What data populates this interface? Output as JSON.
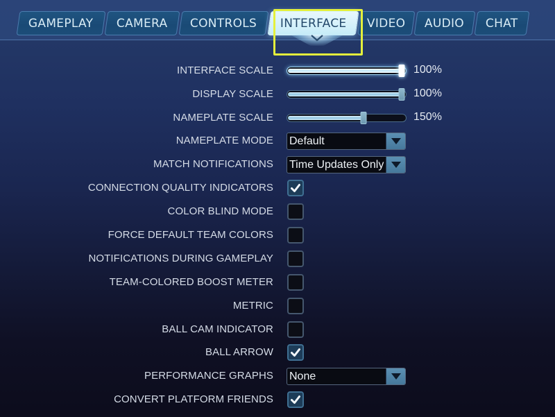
{
  "tabs": [
    {
      "label": "GAMEPLAY",
      "active": false
    },
    {
      "label": "CAMERA",
      "active": false
    },
    {
      "label": "CONTROLS",
      "active": false
    },
    {
      "label": "INTERFACE",
      "active": true
    },
    {
      "label": "VIDEO",
      "active": false
    },
    {
      "label": "AUDIO",
      "active": false
    },
    {
      "label": "CHAT",
      "active": false
    }
  ],
  "colors": {
    "highlight": "#e4f03c",
    "active_tab": "#d6f3fb",
    "accent": "#5b90b2"
  },
  "settings": {
    "interface_scale": {
      "label": "INTERFACE SCALE",
      "value_text": "100%",
      "fraction": 1.0
    },
    "display_scale": {
      "label": "DISPLAY SCALE",
      "value_text": "100%",
      "fraction": 1.0
    },
    "nameplate_scale": {
      "label": "NAMEPLATE SCALE",
      "value_text": "150%",
      "fraction": 0.66
    },
    "nameplate_mode": {
      "label": "NAMEPLATE MODE",
      "selected": "Default"
    },
    "match_notifications": {
      "label": "MATCH NOTIFICATIONS",
      "selected": "Time Updates Only"
    },
    "connection_quality_indicators": {
      "label": "CONNECTION QUALITY INDICATORS",
      "checked": true
    },
    "color_blind_mode": {
      "label": "COLOR BLIND MODE",
      "checked": false
    },
    "force_default_team_colors": {
      "label": "FORCE DEFAULT TEAM COLORS",
      "checked": false
    },
    "notifications_during_gameplay": {
      "label": "NOTIFICATIONS DURING GAMEPLAY",
      "checked": false
    },
    "team_colored_boost_meter": {
      "label": "TEAM-COLORED BOOST METER",
      "checked": false
    },
    "metric": {
      "label": "METRIC",
      "checked": false
    },
    "ball_cam_indicator": {
      "label": "BALL CAM INDICATOR",
      "checked": false
    },
    "ball_arrow": {
      "label": "BALL ARROW",
      "checked": true
    },
    "performance_graphs": {
      "label": "PERFORMANCE GRAPHS",
      "selected": "None"
    },
    "convert_platform_friends": {
      "label": "CONVERT PLATFORM FRIENDS",
      "checked": true
    }
  }
}
